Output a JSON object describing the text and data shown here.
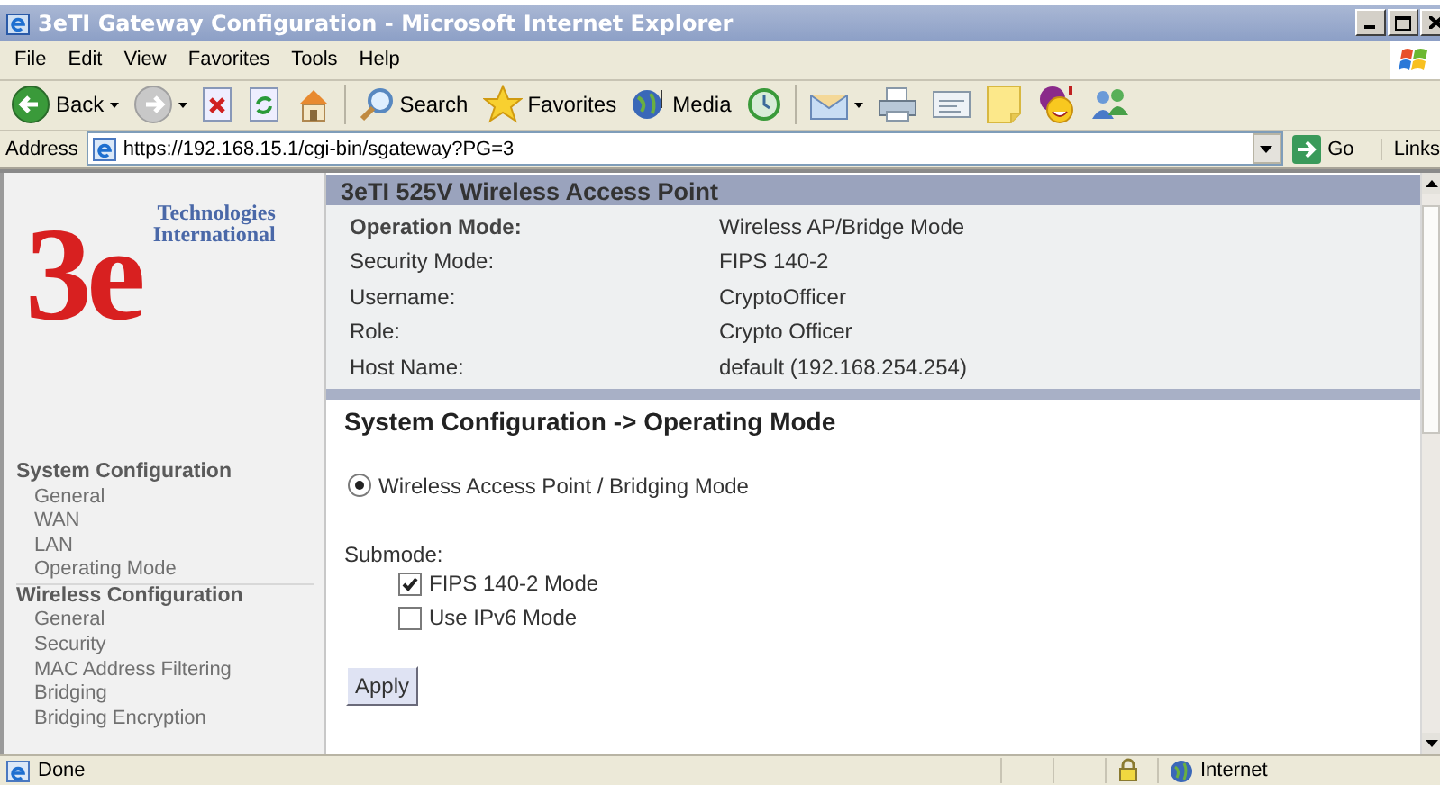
{
  "window": {
    "title": "3eTI Gateway Configuration - Microsoft Internet Explorer"
  },
  "menu": [
    "File",
    "Edit",
    "View",
    "Favorites",
    "Tools",
    "Help"
  ],
  "toolbar": [
    {
      "kind": "back",
      "label": "Back",
      "dropdown": true
    },
    {
      "kind": "forward",
      "dropdown": true
    },
    {
      "kind": "stop"
    },
    {
      "kind": "refresh"
    },
    {
      "kind": "home"
    },
    {
      "kind": "search",
      "label": "Search"
    },
    {
      "kind": "favorites",
      "label": "Favorites"
    },
    {
      "kind": "media",
      "label": "Media"
    },
    {
      "kind": "history"
    },
    {
      "kind": "mail",
      "dropdown": true
    },
    {
      "kind": "print"
    },
    {
      "kind": "edit"
    },
    {
      "kind": "note"
    },
    {
      "kind": "messenger"
    },
    {
      "kind": "people"
    }
  ],
  "address_bar": {
    "label": "Address",
    "value": "https://192.168.15.1/cgi-bin/sgateway?PG=3",
    "go": "Go",
    "links": "Links"
  },
  "logo": {
    "mark": "3e",
    "lines": [
      "Technologies",
      "International"
    ]
  },
  "sidebar": [
    {
      "title": "System Configuration",
      "items": [
        "General",
        "WAN",
        "LAN",
        "Operating Mode"
      ]
    },
    {
      "title": "Wireless Configuration",
      "items": [
        "General",
        "Security",
        "MAC Address Filtering",
        "Bridging",
        "Bridging Encryption"
      ]
    }
  ],
  "info": {
    "title": "3eTI 525V Wireless Access Point",
    "rows": [
      {
        "label": "Operation Mode:",
        "value": "Wireless AP/Bridge Mode",
        "bold": true
      },
      {
        "label": "Security Mode:",
        "value": "FIPS 140-2",
        "bold": false
      },
      {
        "label": "Username:",
        "value": "CryptoOfficer",
        "bold": false
      },
      {
        "label": "Role:",
        "value": "Crypto Officer",
        "bold": false
      },
      {
        "label": "Host Name:",
        "value": "default (192.168.254.254)",
        "bold": false
      }
    ]
  },
  "main": {
    "heading": "System Configuration -> Operating Mode",
    "options": [
      {
        "label": "Wireless Access Point / Bridging Mode",
        "selected": true
      }
    ],
    "submode_label": "Submode:",
    "submodes": [
      {
        "label": "FIPS 140-2 Mode",
        "checked": true
      },
      {
        "label": "Use IPv6 Mode",
        "checked": false
      }
    ],
    "apply": "Apply"
  },
  "status_bar": {
    "text": "Done",
    "zone": "Internet"
  }
}
